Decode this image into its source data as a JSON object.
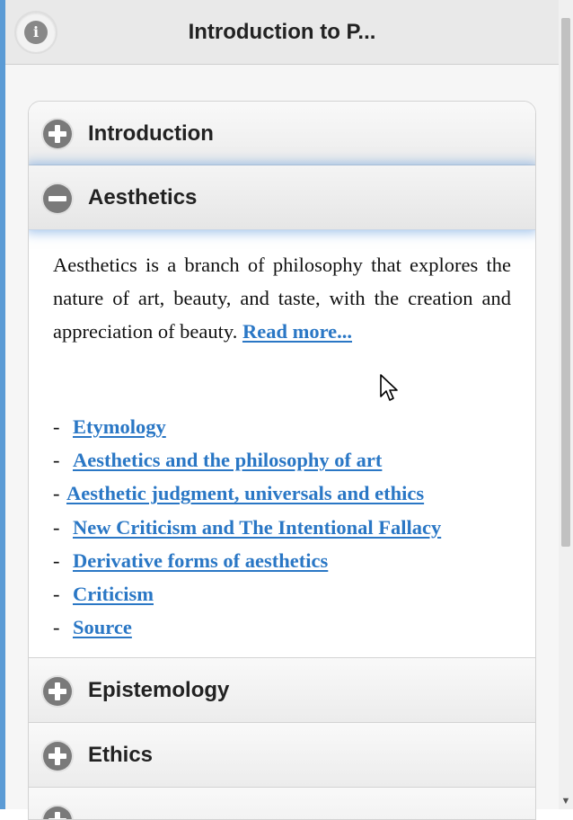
{
  "header": {
    "title": "Introduction to P...",
    "info_icon": "info-icon"
  },
  "sections": [
    {
      "label": "Introduction",
      "state": "collapsed",
      "icon": "plus-icon"
    },
    {
      "label": "Aesthetics",
      "state": "expanded",
      "icon": "minus-icon"
    },
    {
      "label": "Epistemology",
      "state": "collapsed",
      "icon": "plus-icon"
    },
    {
      "label": "Ethics",
      "state": "collapsed",
      "icon": "plus-icon"
    }
  ],
  "aesthetics": {
    "description": "Aesthetics  is a branch of philosophy that explores the nature of art, beauty, and taste, with the creation and appreciation of beauty.",
    "read_more": "Read more...",
    "bullet": "-",
    "topics": [
      "Etymology",
      "Aesthetics and the philosophy of art",
      "Aesthetic judgment, universals and ethics",
      "New Criticism and The Intentional Fallacy",
      "Derivative forms of aesthetics",
      "Criticism",
      "Source"
    ]
  },
  "colors": {
    "link": "#2a77c5",
    "active_glow": "#5a96dc",
    "icon_bg": "#7a7a7a"
  }
}
